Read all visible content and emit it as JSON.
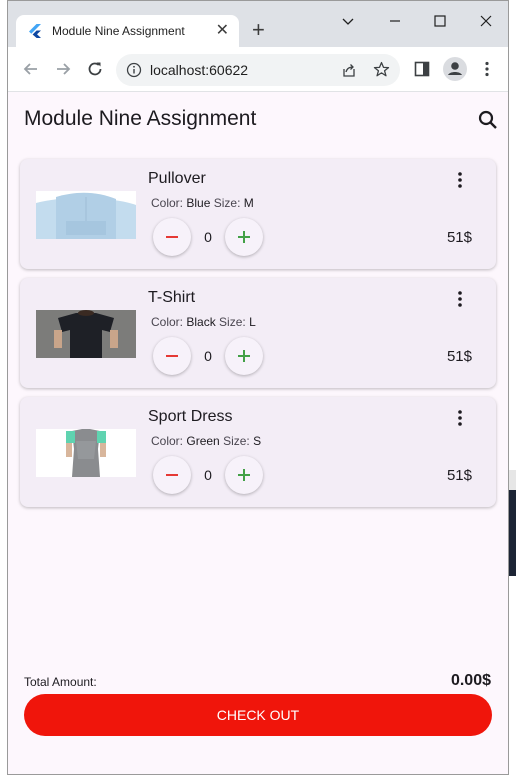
{
  "browser": {
    "tab_title": "Module Nine Assignment",
    "url": "localhost:60622"
  },
  "app": {
    "title": "Module Nine Assignment"
  },
  "labels": {
    "color": "Color:",
    "size": "Size:"
  },
  "products": [
    {
      "name": "Pullover",
      "color": "Blue",
      "size": "M",
      "quantity": "0",
      "price": "51$"
    },
    {
      "name": "T-Shirt",
      "color": "Black",
      "size": "L",
      "quantity": "0",
      "price": "51$"
    },
    {
      "name": "Sport Dress",
      "color": "Green",
      "size": "S",
      "quantity": "0",
      "price": "51$"
    }
  ],
  "summary": {
    "total_label": "Total Amount:",
    "total_value": "0.00$",
    "checkout_label": "CHECK OUT"
  },
  "colors": {
    "accent": "#f0150b",
    "decrement": "#e53935",
    "increment": "#43a047"
  },
  "icons": [
    "flutter-icon",
    "close-icon",
    "plus-icon",
    "chevron-down-icon",
    "minimize-icon",
    "maximize-icon",
    "back-icon",
    "forward-icon",
    "reload-icon",
    "info-icon",
    "share-icon",
    "star-icon",
    "sidepanel-icon",
    "profile-icon",
    "menu-icon",
    "search-icon",
    "more-vert-icon",
    "minus-icon",
    "add-icon"
  ]
}
